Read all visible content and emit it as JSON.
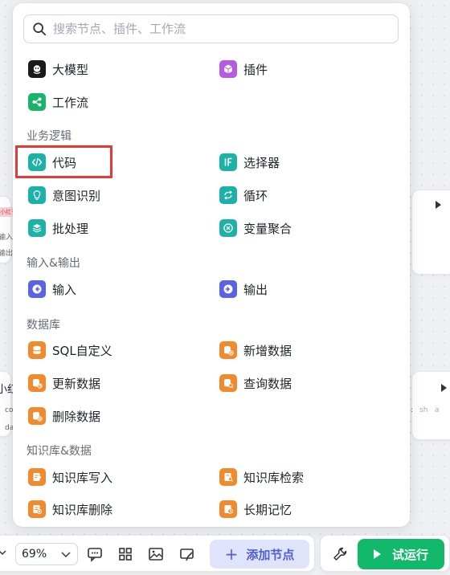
{
  "search": {
    "placeholder": "搜索节点、插件、工作流"
  },
  "items_top": [
    {
      "label": "大模型",
      "icon": "llm-icon",
      "color": "#1a1a1a"
    },
    {
      "label": "插件",
      "icon": "plugin-icon",
      "color": "#b55ae5"
    },
    {
      "label": "工作流",
      "icon": "workflow-icon",
      "color": "#19b36b"
    }
  ],
  "sections": {
    "business_logic": "业务逻辑",
    "io": "输入&输出",
    "database": "数据库",
    "knowledge": "知识库&数据"
  },
  "business_logic": [
    {
      "label": "代码",
      "icon": "code-icon",
      "color": "#1db2a7"
    },
    {
      "label": "选择器",
      "icon": "selector-icon",
      "color": "#1db2a7"
    },
    {
      "label": "意图识别",
      "icon": "intent-icon",
      "color": "#1db2a7"
    },
    {
      "label": "循环",
      "icon": "loop-icon",
      "color": "#1db2a7"
    },
    {
      "label": "批处理",
      "icon": "batch-icon",
      "color": "#1db2a7"
    },
    {
      "label": "变量聚合",
      "icon": "variable-merge-icon",
      "color": "#1db2a7"
    }
  ],
  "io": [
    {
      "label": "输入",
      "icon": "input-icon",
      "color": "#5a62e8"
    },
    {
      "label": "输出",
      "icon": "output-icon",
      "color": "#5a62e8"
    }
  ],
  "database": [
    {
      "label": "SQL自定义",
      "icon": "db-sql-icon",
      "color": "#f08a2c"
    },
    {
      "label": "新增数据",
      "icon": "db-add-icon",
      "color": "#f08a2c"
    },
    {
      "label": "更新数据",
      "icon": "db-update-icon",
      "color": "#f08a2c"
    },
    {
      "label": "查询数据",
      "icon": "db-query-icon",
      "color": "#f08a2c"
    },
    {
      "label": "删除数据",
      "icon": "db-delete-icon",
      "color": "#f08a2c"
    }
  ],
  "knowledge": [
    {
      "label": "知识库写入",
      "icon": "kb-write-icon",
      "color": "#f08a2c"
    },
    {
      "label": "知识库检索",
      "icon": "kb-search-icon",
      "color": "#f08a2c"
    },
    {
      "label": "知识库删除",
      "icon": "kb-delete-icon",
      "color": "#f08a2c"
    },
    {
      "label": "长期记忆",
      "icon": "memory-icon",
      "color": "#f08a2c"
    }
  ],
  "toolbar": {
    "zoom": "69%",
    "add_node": "添加节点",
    "run": "试运行"
  },
  "background": {
    "node_badge": "小红书",
    "left_texts": [
      "输入",
      "输出"
    ],
    "char_red": "小红",
    "frag1": "co",
    "frag2": "da",
    "frag3": "sh",
    "frag4": "a",
    "colon": ":"
  },
  "colors": {
    "accent": "#4e5ed3",
    "run": "#13b96b",
    "highlight": "#e53935"
  }
}
